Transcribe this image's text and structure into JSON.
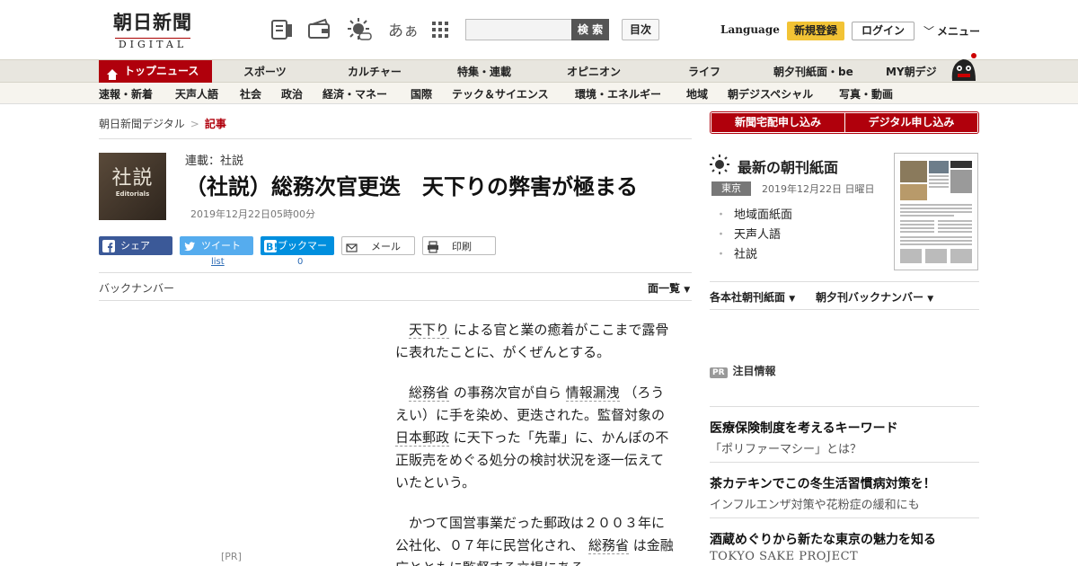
{
  "logo": {
    "main": "朝日新聞",
    "sub": "DIGITAL"
  },
  "header": {
    "icons": [
      "newspaper-icon",
      "wallet-icon",
      "sun-icon",
      "font-size-icon",
      "grid-icon"
    ],
    "font_size_label": "あぁ",
    "search_placeholder": "",
    "search_button": "検 索",
    "index_button": "目次",
    "language": "Language",
    "signup": "新規登録",
    "login": "ログイン",
    "menu": "メニュー"
  },
  "nav_primary": [
    "トップニュース",
    "スポーツ",
    "カルチャー",
    "特集・連載",
    "オピニオン",
    "ライフ",
    "朝夕刊紙面・be",
    "MY朝デジ"
  ],
  "nav_secondary": [
    "速報・新着",
    "天声人語",
    "社会",
    "政治",
    "経済・マネー",
    "国際",
    "テック＆サイエンス",
    "環境・エネルギー",
    "地域",
    "朝デジスペシャル",
    "写真・動画"
  ],
  "breadcrumb": {
    "home": "朝日新聞デジタル",
    "sep": ">",
    "current": "記事"
  },
  "article": {
    "thumb_big": "社説",
    "thumb_small": "Editorials",
    "series": "連載：社説",
    "title": "（社説）総務次官更迭　天下りの弊害が極まる",
    "date": "2019年12月22日05時00分",
    "share": {
      "facebook": "シェア",
      "twitter": "ツイート",
      "hatena": "ブックマーク",
      "mail": "メール",
      "print": "印刷"
    },
    "twitter_count": "list",
    "hatena_count": "0",
    "back_number": "バックナンバー",
    "list_label": "面一覧",
    "paragraphs": [
      {
        "kw1": "天下り",
        "rest1": "による官と業の癒着がここまで露骨に表れたことに、がくぜんとする。"
      },
      {
        "kw1": "総務省",
        "mid": "の事務次官が自ら",
        "kw2": "情報漏洩",
        "mid2": "（ろうえい）に手を染め、更迭された。監督対象の",
        "kw3": "日本郵政",
        "rest": "に天下った「先輩」に、かんぽの不正販売をめぐる処分の検討状況を逐一伝えていたという。"
      },
      {
        "start": "かつて国営事業だった郵政は２００３年に公社化、０７年に民営化され、",
        "kw1": "総務省",
        "rest": "は金融庁とともに監督する立場にある。"
      }
    ],
    "pr_label": "[PR]"
  },
  "sidebar": {
    "btn_paper": "新聞宅配申し込み",
    "btn_digital": "デジタル申し込み",
    "latest": "最新の朝刊紙面",
    "region": "東京",
    "paper_date": "2019年12月22日 日曜日",
    "paper_links": [
      "地域面紙面",
      "天声人語",
      "社説"
    ],
    "dropdown1": "各本社朝刊紙面",
    "dropdown2": "朝夕刊バックナンバー",
    "pr_tag": "PR",
    "pr_title": "注目情報",
    "pr_items": [
      {
        "title": "医療保険制度を考えるキーワード",
        "sub": "「ポリファーマシー」とは？"
      },
      {
        "title": "茶カテキンでこの冬生活習慣病対策を！",
        "sub": "インフルエンザ対策や花粉症の緩和にも"
      },
      {
        "title": "酒蔵めぐりから新たな東京の魅力を知る",
        "sub": "TOKYO SAKE PROJECT"
      }
    ]
  },
  "colors": {
    "brand_red": "#b0000c",
    "signup_yellow": "#f2c335",
    "facebook": "#3b5998",
    "twitter": "#55acee",
    "hatena": "#008fde"
  }
}
